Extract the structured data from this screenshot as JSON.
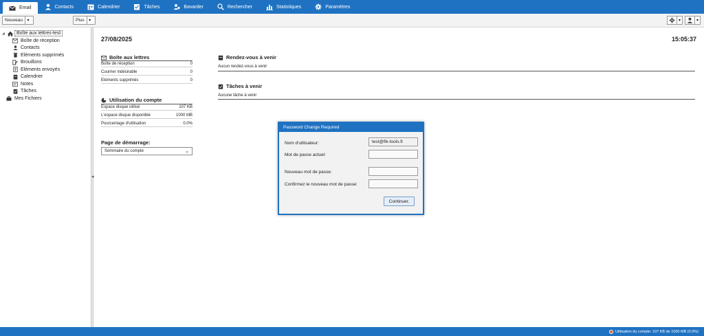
{
  "nav": {
    "tabs": [
      {
        "label": "Email",
        "icon": "envelope-icon"
      },
      {
        "label": "Contacts",
        "icon": "person-icon"
      },
      {
        "label": "Calendrier",
        "icon": "calendar-icon"
      },
      {
        "label": "Tâches",
        "icon": "tasks-icon"
      },
      {
        "label": "Bavarder",
        "icon": "chat-icon"
      },
      {
        "label": "Rechercher",
        "icon": "search-icon"
      },
      {
        "label": "Statistiques",
        "icon": "bar-chart-icon"
      },
      {
        "label": "Paramètres",
        "icon": "gear-icon"
      }
    ],
    "active_tab": "Email",
    "bar_color": "#1f72c2"
  },
  "toolbar": {
    "new_label": "Nouveau",
    "more_label": "Plus"
  },
  "sidebar": {
    "root_label": "Boîte aux lettres-test",
    "items": [
      {
        "label": "Boîte de réception",
        "icon": "inbox-icon"
      },
      {
        "label": "Contacts",
        "icon": "person-icon"
      },
      {
        "label": "Eléments supprimés",
        "icon": "trash-icon"
      },
      {
        "label": "Brouillons",
        "icon": "draft-icon"
      },
      {
        "label": "Eléments envoyés",
        "icon": "sent-icon"
      },
      {
        "label": "Calendrier",
        "icon": "calendar-icon"
      },
      {
        "label": "Notes",
        "icon": "note-icon"
      },
      {
        "label": "Tâches",
        "icon": "tasks-icon"
      }
    ],
    "files_label": "Mes Fichiers"
  },
  "main": {
    "date": "27/08/2025",
    "time": "15:05:37",
    "mailbox": {
      "title": "Boîte aux lettres",
      "rows": [
        {
          "label": "Boîte de réception",
          "value": "0"
        },
        {
          "label": "Courrier indésirable",
          "value": "0"
        },
        {
          "label": "Eléments supprimés",
          "value": "0"
        }
      ]
    },
    "usage": {
      "title": "Utilisation du compte",
      "rows": [
        {
          "label": "Espace disque utilisé",
          "value": "107 KB"
        },
        {
          "label": "L'espace disque disponible",
          "value": "1000 MB"
        },
        {
          "label": "Pourcentage d'utilisation",
          "value": "0.0%"
        }
      ]
    },
    "startup": {
      "title": "Page de démarrage:",
      "selected": "Sommaire du compte"
    },
    "appointments": {
      "title": "Rendez-vous à venir",
      "empty": "Aucun rendez-vous à venir"
    },
    "tasks": {
      "title": "Tâches à venir",
      "empty": "Aucune tâche à venir"
    }
  },
  "modal": {
    "title": "Password Change Required",
    "username_label": "Nom d'utilisateur:",
    "username_value": "test@fik-tools.fr",
    "current_pw_label": "Mot de passe actuel:",
    "new_pw_label": "Nouveau mot de passe:",
    "confirm_pw_label": "Confirmez le nouveau mot de passe:",
    "continue_label": "Continuer."
  },
  "status": {
    "text": "Utilisation du compte: 107 KB de 1000 MB (0.0%)"
  }
}
